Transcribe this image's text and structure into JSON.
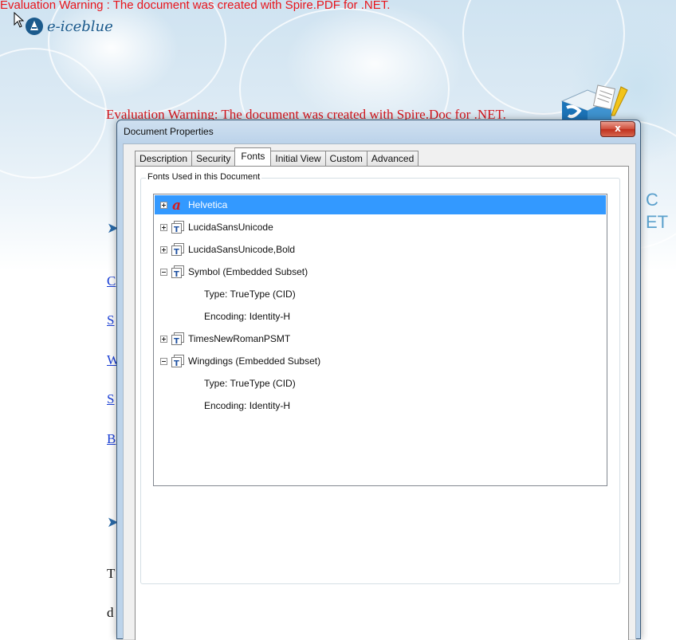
{
  "background": {
    "pdf_warning": "Evaluation Warning : The document was created with Spire.PDF for .NET.",
    "logo_text": "e-iceblue",
    "doc_warning": "Evaluation Warning: The document was created with Spire.Doc for .NET.",
    "bullet_glyph": "➤",
    "side_links": [
      "C",
      "S",
      "W",
      "S",
      "B"
    ],
    "side_texts": [
      "T",
      "d"
    ],
    "right_letters": [
      "C",
      "ET"
    ]
  },
  "dialog": {
    "title": "Document Properties",
    "close_glyph": "x",
    "tabs": [
      {
        "label": "Description"
      },
      {
        "label": "Security"
      },
      {
        "label": "Fonts"
      },
      {
        "label": "Initial View"
      },
      {
        "label": "Custom"
      },
      {
        "label": "Advanced"
      }
    ],
    "active_tab": "Fonts",
    "group_title": "Fonts Used in this Document",
    "fonts": [
      {
        "name": "Helvetica",
        "icon": "font-type1-icon",
        "expanded": false,
        "selected": true,
        "details": []
      },
      {
        "name": "LucidaSansUnicode",
        "icon": "truetype-icon",
        "expanded": false,
        "selected": false,
        "details": []
      },
      {
        "name": "LucidaSansUnicode,Bold",
        "icon": "truetype-icon",
        "expanded": false,
        "selected": false,
        "details": []
      },
      {
        "name": "Symbol (Embedded Subset)",
        "icon": "truetype-icon",
        "expanded": true,
        "selected": false,
        "details": [
          "Type: TrueType (CID)",
          "Encoding: Identity-H"
        ]
      },
      {
        "name": "TimesNewRomanPSMT",
        "icon": "truetype-icon",
        "expanded": false,
        "selected": false,
        "details": []
      },
      {
        "name": "Wingdings (Embedded Subset)",
        "icon": "truetype-icon",
        "expanded": true,
        "selected": false,
        "details": [
          "Type: TrueType (CID)",
          "Encoding: Identity-H"
        ]
      }
    ]
  },
  "colors": {
    "warning_red": "#e8141b",
    "selection_blue": "#3399ff",
    "link_blue": "#1a3fd6",
    "type1_icon_red": "#d71d1d"
  }
}
